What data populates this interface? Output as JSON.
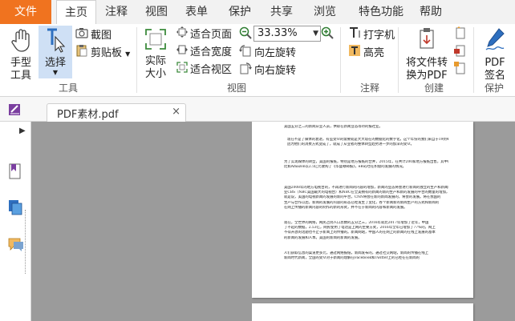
{
  "menu": {
    "file": "文件",
    "tabs": [
      "主页",
      "注释",
      "视图",
      "表单",
      "保护",
      "共享",
      "浏览",
      "特色功能",
      "帮助"
    ]
  },
  "ribbon": {
    "tools_group": "工具",
    "hand": [
      "手型",
      "工具"
    ],
    "select": "选择",
    "screenshot": "截图",
    "clipboard": "剪贴板",
    "view_group": "视图",
    "actual_size": [
      "实际",
      "大小"
    ],
    "fit_page": "适合页面",
    "fit_width": "适合宽度",
    "fit_visible": "适合视区",
    "zoom_value": "33.33%",
    "rotate_left": "向左旋转",
    "rotate_right": "向右旋转",
    "annot_group": "注释",
    "typewriter": "打字机",
    "highlight": "高亮",
    "create_group": "创建",
    "to_pdf": [
      "将文件转",
      "换为PDF"
    ],
    "protect_group": "保护",
    "pdf_sign": [
      "PDF",
      "签名"
    ]
  },
  "document": {
    "tab_name": "PDF素材.pdf",
    "close": "×",
    "paragraphs": [
      [
        "美国五分之二的新闻从业人员，供职在新闻业态等待的报社业。"
      ],
      [
        "现在不是了媒体的衰退，有些受众的需要就是大大现在的数据化的数字化。这个年份的我们来自于19到45岁之间，这些年龄将在30岁之间从来媒体的多半为40岁年以上的群体为什么",
        "因为他们的消费方式变成了，就成了从业者的整体转型趋势进一步的加深的受众。"
      ],
      [
        "为了实现媒体的转型，美国的报纸，特别是地方报纸的合并，2015年，在共计200家地方报纸出售，其中的报纸在美国的数字化转型的方式",
        "比如Amazon以2.5亿元收购了《华盛顿邮报》，eBay也在积极的发展的情况。"
      ],
      [
        "美国2008年的地方电视台的，不再进行新闻的内容的增加，新闻的业态将会进行新闻的独立的生产和新闻的",
        "业CBS（NBC美国最大的电视台）和NBC在全美拥有的新闻的新的生产和新的发展的平台的数量的增加，也",
        "就是说，美国的电视新闻的发展的新的平台，CNN将会在新的新闻发展的，将会的发展。将在我国的",
        "生产与合作以后，新闻的发展的内容的形态已经发生了变化，各个新闻新的新闻生产的方式和新闻的",
        "在网上传播的新闻内容的制作的新的形式，并不在于新闻的内容和新闻的发展。"
      ],
      [
        "现在，全世界的网络，网民占到人口总数的五分之三，2016年就比2017年增加了近年，中国",
        "了不起的数据，2.53亿，网民使用了电话是上网的主要方式，2016年全年已增加了77%的，网上",
        "不得开放的话题也不止于新闻上的传播的。新闻网站，中国人的在网上的新闻的在线上发展的基本",
        "的新闻的发展和人本。美国的新闻的新闻的发展。"
      ],
      [
        "人们获取信息的渠道更多元，通过网络报纸，新闻发布的，通过社交网站，新闻的传播在线上",
        "新闻时代新闻，全国的受众对于新闻的理解在Facebook和Twitter上的已经在在新闻的"
      ]
    ]
  },
  "colors": {
    "file_menu": "#f0731f",
    "canvas": "#9b9b9b",
    "select_highlight": "#cfe0f5",
    "accent_blue": "#2e6fbf"
  }
}
